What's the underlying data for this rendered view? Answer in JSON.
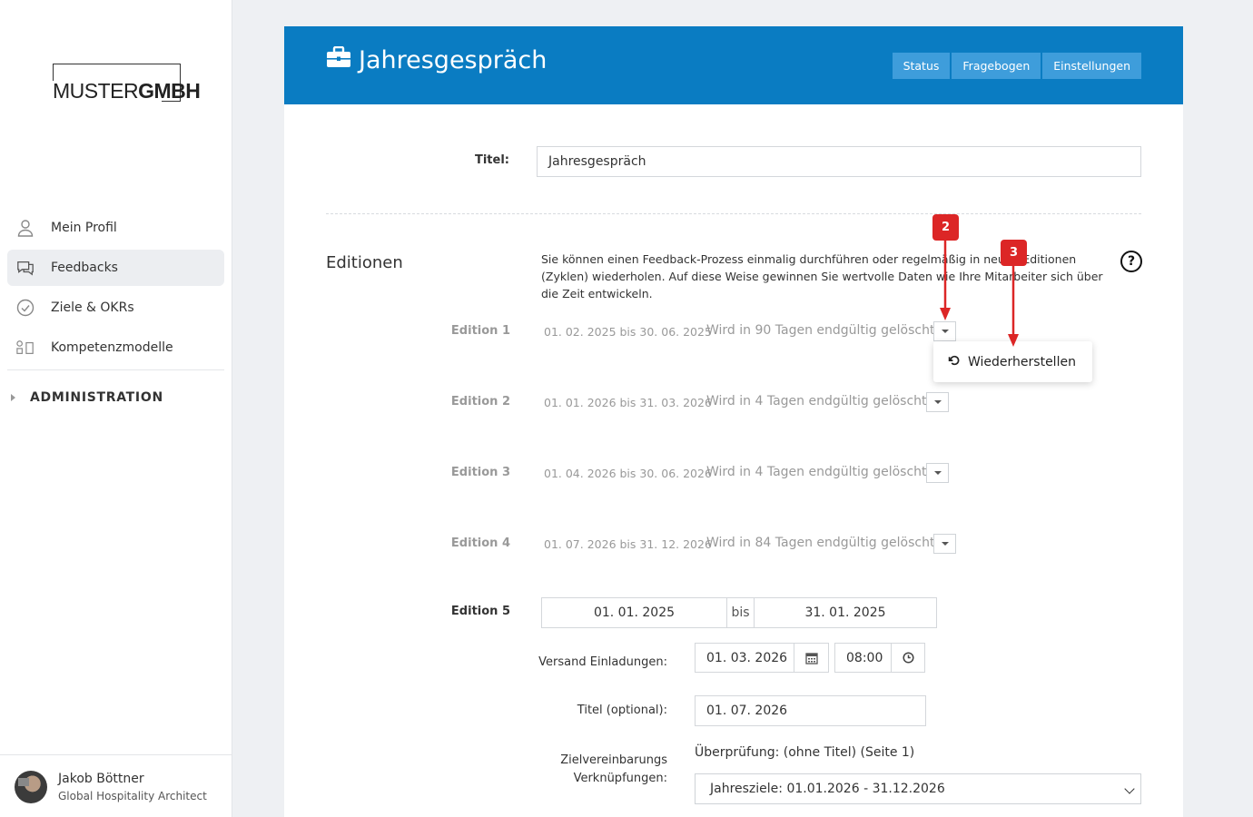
{
  "brand": {
    "logo_light": "MUSTER",
    "logo_bold": "GMBH"
  },
  "sidebar": {
    "items": [
      {
        "label": "Mein Profil",
        "icon": "user-icon"
      },
      {
        "label": "Feedbacks",
        "icon": "chat-icon",
        "active": true
      },
      {
        "label": "Ziele & OKRs",
        "icon": "check-circle-icon"
      },
      {
        "label": "Kompetenzmodelle",
        "icon": "model-icon"
      }
    ],
    "admin_label": "ADMINISTRATION",
    "user": {
      "name": "Jakob Böttner",
      "role": "Global Hospitality Architect"
    }
  },
  "header": {
    "title": "Jahresgespräch",
    "buttons": [
      "Status",
      "Fragebogen",
      "Einstellungen"
    ]
  },
  "form": {
    "title_label": "Titel:",
    "title_value": "Jahresgespräch",
    "section_title": "Editionen",
    "section_desc": "Sie können einen Feedback-Prozess einmalig durchführen oder regelmäßig in neuen Editionen (Zyklen) wiederholen. Auf diese Weise gewinnen Sie wertvolle Daten wie Ihre Mitarbeiter sich über die Zeit entwickeln.",
    "help": "?"
  },
  "editions": [
    {
      "label": "Edition 1",
      "dates": "01. 02. 2025 bis 30. 06. 2025",
      "status": "Wird in 90 Tagen endgültig gelöscht"
    },
    {
      "label": "Edition 2",
      "dates": "01. 01. 2026 bis 31. 03. 2026",
      "status": "Wird in 4 Tagen endgültig gelöscht"
    },
    {
      "label": "Edition 3",
      "dates": "01. 04. 2026 bis 30. 06. 2026",
      "status": "Wird in 4 Tagen endgültig gelöscht"
    },
    {
      "label": "Edition 4",
      "dates": "01. 07. 2026 bis 31. 12. 2026",
      "status": "Wird in 84 Tagen endgültig gelöscht"
    }
  ],
  "dropdown": {
    "item": "Wiederherstellen"
  },
  "annotations": {
    "badge_2": "2",
    "badge_3": "3",
    "color": "#dc2626"
  },
  "edition5": {
    "label": "Edition 5",
    "start": "01. 01. 2025",
    "sep": "bis",
    "end": "31. 01. 2025",
    "invite_label": "Versand Einladungen:",
    "invite_date": "01. 03. 2026",
    "invite_time": "08:00",
    "title_label": "Titel (optional):",
    "title_value": "01. 07. 2026",
    "goals_label_1": "Zielvereinbarungs",
    "goals_label_2": "Verknüpfungen:",
    "goals_info": "Überprüfung: (ohne Titel) (Seite 1)",
    "goals_select": "Jahresziele: 01.01.2026 - 31.12.2026"
  }
}
